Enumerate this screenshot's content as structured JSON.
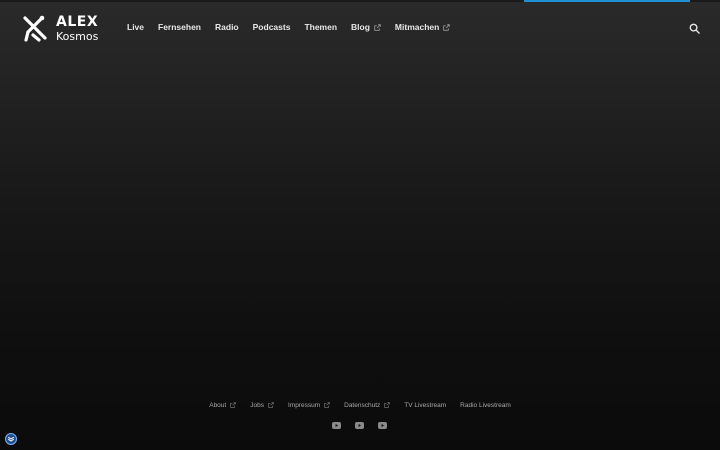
{
  "brand": {
    "line1": "ALEX",
    "line2": "Kosmos",
    "logo_icon": "alex-logo-icon"
  },
  "colors": {
    "accent": "#1f8fd6",
    "background_top": "#2a2a2a",
    "background_bottom": "#0b0b0b",
    "text": "#e8e8e8",
    "footer_text": "#a8a8a8"
  },
  "page_load_progress": 0.23,
  "nav": {
    "items": [
      {
        "label": "Live",
        "external": false
      },
      {
        "label": "Fernsehen",
        "external": false
      },
      {
        "label": "Radio",
        "external": false
      },
      {
        "label": "Podcasts",
        "external": false
      },
      {
        "label": "Themen",
        "external": false
      },
      {
        "label": "Blog",
        "external": true
      },
      {
        "label": "Mitmachen",
        "external": true
      }
    ],
    "search_icon": "search-icon"
  },
  "footer": {
    "links": [
      {
        "label": "About",
        "external": true
      },
      {
        "label": "Jobs",
        "external": true
      },
      {
        "label": "Impressum",
        "external": true
      },
      {
        "label": "Datenschutz",
        "external": true
      },
      {
        "label": "TV Livestream",
        "external": false
      },
      {
        "label": "Radio Livestream",
        "external": false
      }
    ],
    "social_icons": [
      "youtube-icon",
      "youtube-icon",
      "youtube-icon"
    ]
  },
  "consent_icon": "cookie-consent-icon"
}
